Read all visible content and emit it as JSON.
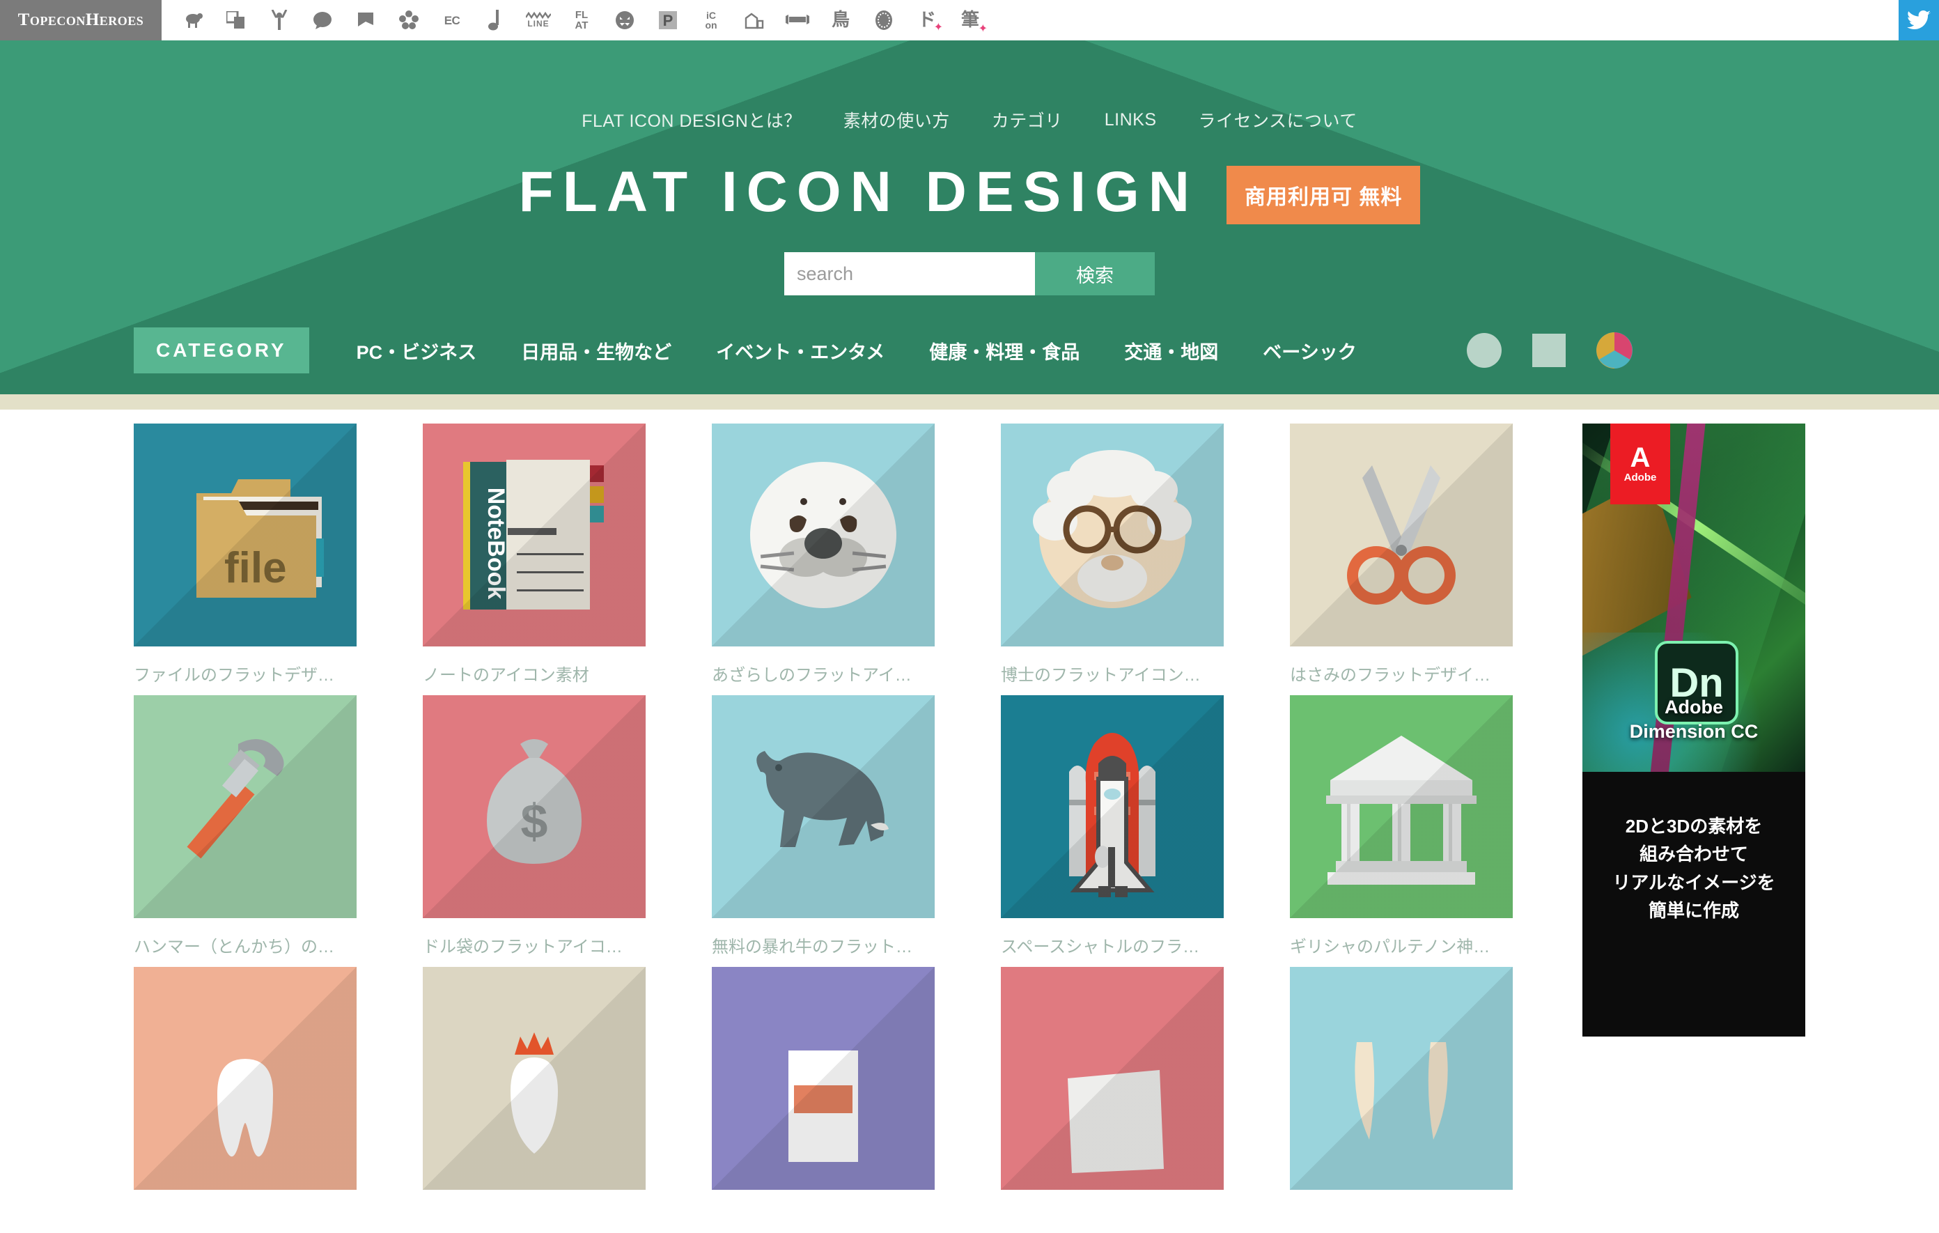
{
  "topbar": {
    "brand": "TopeconHeroes",
    "icons": [
      {
        "name": "sheep-icon",
        "glyph": "ὁ1"
      },
      {
        "name": "copy-icon",
        "glyph": "⧉"
      },
      {
        "name": "person-cheer-icon",
        "glyph": "Щ"
      },
      {
        "name": "speech-bubble-icon",
        "glyph": "●"
      },
      {
        "name": "flag-icon",
        "glyph": "⚑"
      },
      {
        "name": "flower-icon",
        "glyph": "✿"
      },
      {
        "name": "ec-icon",
        "glyph": "EC"
      },
      {
        "name": "music-note-icon",
        "glyph": "♪"
      },
      {
        "name": "line-icon",
        "glyph": "LINE"
      },
      {
        "name": "flat-icon",
        "glyph": "FLAT"
      },
      {
        "name": "ghost-icon",
        "glyph": "☻"
      },
      {
        "name": "parking-icon",
        "glyph": "P"
      },
      {
        "name": "icon-icon",
        "glyph": "icon"
      },
      {
        "name": "building-icon",
        "glyph": "Ἶ2"
      },
      {
        "name": "sofa-icon",
        "glyph": "▬"
      },
      {
        "name": "bird-kanji-icon",
        "glyph": "鳥"
      },
      {
        "name": "pattern-circle-icon",
        "glyph": "◉"
      },
      {
        "name": "do-sparkle-icon",
        "glyph": "ド"
      },
      {
        "name": "brush-kanji-icon",
        "glyph": "筆"
      }
    ],
    "twitter_label": "twitter-bird-icon"
  },
  "nav": {
    "items": [
      {
        "label": "FLAT ICON DESIGNとは？",
        "name": "nav-about"
      },
      {
        "label": "素材の使い方",
        "name": "nav-usage"
      },
      {
        "label": "カテゴリ",
        "name": "nav-category"
      },
      {
        "label": "LINKS",
        "name": "nav-links"
      },
      {
        "label": "ライセンスについて",
        "name": "nav-license"
      }
    ]
  },
  "hero": {
    "title": "FLAT ICON DESIGN",
    "free_badge": "商用利用可 無料",
    "accent_green": "#328a68",
    "accent_orange": "#f08a4b"
  },
  "search": {
    "placeholder": "search",
    "value": "",
    "button_label": "検索"
  },
  "category": {
    "badge": "CATEGORY",
    "items": [
      {
        "label": "PC・ビジネス",
        "name": "category-pc-business"
      },
      {
        "label": "日用品・生物など",
        "name": "category-daily-goods"
      },
      {
        "label": "イベント・エンタメ",
        "name": "category-event-entertainment"
      },
      {
        "label": "健康・料理・食品",
        "name": "category-health-food"
      },
      {
        "label": "交通・地図",
        "name": "category-transport-map"
      },
      {
        "label": "ベーシック",
        "name": "category-basic"
      }
    ],
    "shape_filters": [
      {
        "name": "shape-filter-circle",
        "color": "#b9d4c8"
      },
      {
        "name": "shape-filter-square",
        "color": "#b9d4c8"
      },
      {
        "name": "shape-filter-color-pie",
        "colors": [
          "#d8456f",
          "#d6a83a",
          "#4cb3c0"
        ]
      }
    ]
  },
  "grid": {
    "row1": [
      {
        "caption": "ファイルのフラットデザ…",
        "bg": "#2a8a9e",
        "icon": "file-folder-icon"
      },
      {
        "caption": "ノートのアイコン素材",
        "bg": "#e07a80",
        "icon": "notebook-icon"
      },
      {
        "caption": "あざらしのフラットアイ…",
        "bg": "#9ad4dc",
        "icon": "seal-icon"
      },
      {
        "caption": "博士のフラットアイコン…",
        "bg": "#9ad4dc",
        "icon": "professor-icon"
      },
      {
        "caption": "はさみのフラットデザイ…",
        "bg": "#e4ddc7",
        "icon": "scissors-icon"
      }
    ],
    "row2": [
      {
        "caption": "ハンマー（とんかち）の…",
        "bg": "#9ccfa8",
        "icon": "hammer-icon"
      },
      {
        "caption": "ドル袋のフラットアイコ…",
        "bg": "#e07a80",
        "icon": "money-bag-icon"
      },
      {
        "caption": "無料の暴れ牛のフラット…",
        "bg": "#9ad4dc",
        "icon": "bull-icon"
      },
      {
        "caption": "スペースシャトルのフラ…",
        "bg": "#1b7e92",
        "icon": "space-shuttle-icon"
      },
      {
        "caption": "ギリシャのパルテノン神…",
        "bg": "#6cc070",
        "icon": "parthenon-icon"
      }
    ],
    "row3": [
      {
        "caption": "",
        "bg": "#f0b094",
        "icon": "tooth-icon"
      },
      {
        "caption": "",
        "bg": "#dcd6c2",
        "icon": "rooster-icon"
      },
      {
        "caption": "",
        "bg": "#8a85c4",
        "icon": "drink-cup-icon"
      },
      {
        "caption": "",
        "bg": "#e07a80",
        "icon": "paper-icon"
      },
      {
        "caption": "",
        "bg": "#9ad4dc",
        "icon": "horns-icon"
      }
    ]
  },
  "ad": {
    "brand": "Adobe",
    "brand_mark": "A",
    "product_badge": "Dn",
    "title": "Adobe\nDimension CC",
    "title_line1": "Adobe",
    "title_line2": "Dimension CC",
    "body_line1": "2Dと3Dの素材を",
    "body_line2": "組み合わせて",
    "body_line3": "リアルなイメージを",
    "body_line4": "簡単に作成"
  }
}
